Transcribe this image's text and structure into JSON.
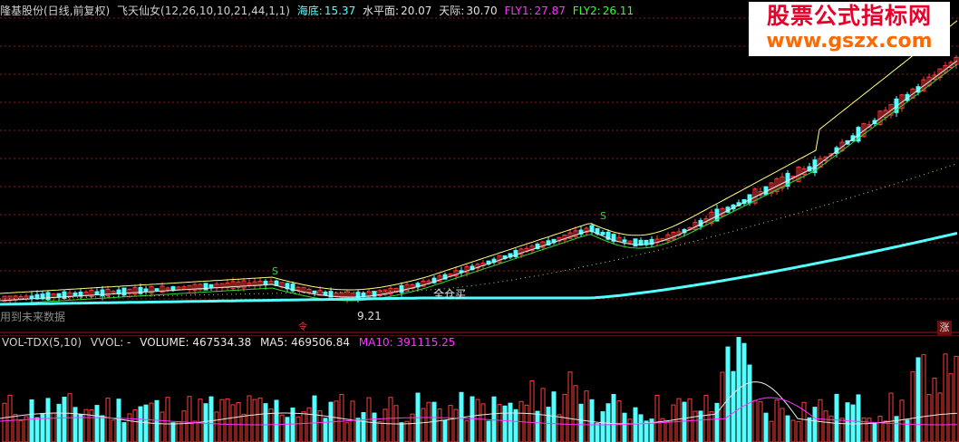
{
  "header": {
    "stock_name": "隆基股份(日线,前复权)",
    "indicator_name": "飞天仙女(12,26,10,10,21,44,1,1)",
    "haidi_label": "海底:",
    "haidi_value": "15.37",
    "shuipingmian_label": "水平面:",
    "shuipingmian_value": "20.07",
    "tianji_label": "天际:",
    "tianji_value": "30.70",
    "fly1_label": "FLY1:",
    "fly1_value": "27.87",
    "fly2_label": "FLY2:",
    "fly2_value": "26.11"
  },
  "watermark": {
    "line1": "股票公式指标网",
    "line2": "www.gszx.com"
  },
  "annotations": {
    "buy_label": "全仓买",
    "low_price": "9.21",
    "s_marker": "S",
    "future_note": "用到未来数据",
    "red_badge": "涨",
    "down_marker": "令"
  },
  "volume_header": {
    "indicator": "VOL-TDX(5,10)",
    "vvol": "VVOL: -",
    "volume": "VOLUME: 467534.38",
    "ma5": "MA5: 469506.84",
    "ma10": "MA10: 391115.25"
  },
  "colors": {
    "background": "#000000",
    "up": "#ff3b3b",
    "down": "#54ffff",
    "ma_white": "#e8e8e8",
    "ma_yellow": "#ffff80",
    "ma_green": "#33dd33",
    "ma10_magenta": "#ff33ff",
    "haidi_cyan": "#54ffff",
    "fly1_magenta": "#ff33ff",
    "fly2_green": "#33ff33",
    "grid": "#8b1a1a"
  }
}
